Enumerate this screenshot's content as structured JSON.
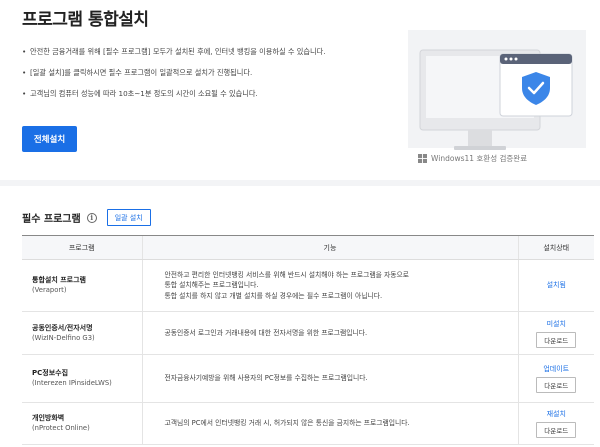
{
  "page": {
    "title": "프로그램 통합설치"
  },
  "notices": [
    "안전한 금융거래를 위해 [필수 프로그램] 모두가 설치된 후에, 인터넷 뱅킹을 이용하실 수 있습니다.",
    "[일괄 설치]를 클릭하시면 필수 프로그램이 일괄적으로 설치가 진행됩니다.",
    "고객님의 컴퓨터 성능에 따라 10초~1분 정도의 시간이 소요될 수 있습니다."
  ],
  "actions": {
    "install_all": "전체설치"
  },
  "illustration": {
    "icon": "monitor-shield-icon",
    "compat_note": "Windows11 호환성 검증완료"
  },
  "section": {
    "title": "필수 프로그램",
    "partial_install": "일괄 설치"
  },
  "table": {
    "headers": {
      "program": "프로그램",
      "feature": "기능",
      "status": "설치상태"
    },
    "rows": [
      {
        "name": "통합설치 프로그램",
        "sub": "(Veraport)",
        "desc": [
          "안전하고 편리한 인터넷뱅킹 서비스를 위해 반드시 설치해야 하는 프로그램을 자동으로",
          "통합 설치해주는 프로그램입니다.",
          "통합 설치를 하지 않고 개별 설치를 하실 경우에는 필수 프로그램이 아닙니다."
        ],
        "status": "설치됨",
        "button": ""
      },
      {
        "name": "공동인증서/전자서명",
        "sub": "(WizIN-Delfino G3)",
        "desc": [
          "공동인증서 로그인과 거래내용에 대한 전자서명을 위한 프로그램입니다."
        ],
        "status": "미설치",
        "button": "다운로드"
      },
      {
        "name": "PC정보수집",
        "sub": "(Interezen IPinsideLWS)",
        "desc": [
          "전자금융사기예방을 위해 사용자의 PC정보를 수집하는 프로그램입니다."
        ],
        "status": "업데이트",
        "button": "다운로드"
      },
      {
        "name": "개인방화벽",
        "sub": "(nProtect Online)",
        "desc": [
          "고객님의 PC에서 인터넷뱅킹 거래 시, 허가되지 않은 통신을 금지하는 프로그램입니다."
        ],
        "status": "재설치",
        "button": "다운로드"
      }
    ]
  },
  "colors": {
    "accent": "#1a6fe6",
    "shield": "#3b86e8"
  }
}
